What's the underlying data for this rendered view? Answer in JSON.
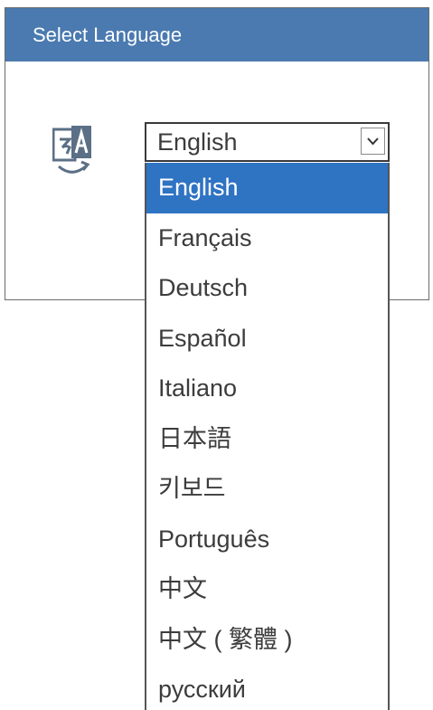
{
  "dialog": {
    "title": "Select Language",
    "language_icon": "translate-icon"
  },
  "select": {
    "current_value": "English",
    "arrow_icon": "chevron-down-icon"
  },
  "dropdown": {
    "selected_index": 0,
    "options": [
      {
        "label": "English"
      },
      {
        "label": "Français"
      },
      {
        "label": "Deutsch"
      },
      {
        "label": "Español"
      },
      {
        "label": "Italiano"
      },
      {
        "label": "日本語"
      },
      {
        "label": "키보드"
      },
      {
        "label": "Português"
      },
      {
        "label": "中文"
      },
      {
        "label": "中文 ( 繁體 )"
      },
      {
        "label": "русский"
      }
    ]
  },
  "colors": {
    "titlebar": "#4a7ab0",
    "selected_option": "#2f73c3"
  }
}
